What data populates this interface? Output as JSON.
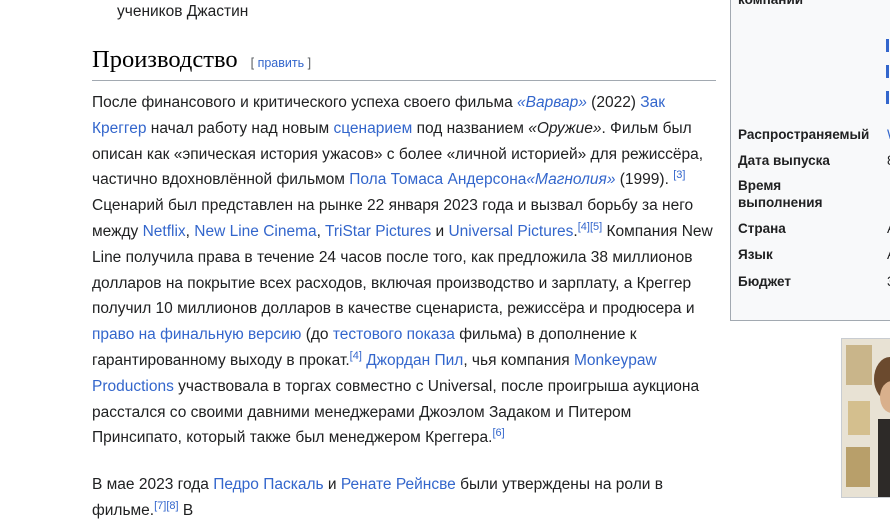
{
  "top_fragment": "учеников Джастин",
  "section": {
    "title": "Производство",
    "edit_open": "[ ",
    "edit_label": "править",
    "edit_close": " ]"
  },
  "para1": {
    "t01": "После финансового и критического успеха своего фильма ",
    "l01": "«Варвар»",
    "t02": " (2022) ",
    "l02": "Зак Креггер",
    "t03": " начал работу над новым ",
    "l03": "сценарием",
    "t04": " под названием ",
    "t05": "«Оружие»",
    "t06": ". Фильм был описан как «эпическая история ужасов» с более «личной историей» для режиссёра, частично вдохновлённой фильмом ",
    "l04": "Пола Томаса Андерсона",
    "l05": "«Магнолия»",
    "t07": " (1999).",
    "r01": "[3]",
    "t08": " Сценарий был представлен на рынке 22 января 2023 года и вызвал борьбу за него между ",
    "l06": "Netflix",
    "t09": ", ",
    "l07": "New Line Cinema",
    "t10": ", ",
    "l08": "TriStar Pictures",
    "t11": " и ",
    "l09": "Universal Pictures",
    "t12": ".",
    "r02": "[4]",
    "r03": "[5]",
    "t13": " Компания New Line получила права в течение 24 часов после того, как предложила 38  миллионов долларов на покрытие всех расходов, включая производство и зарплату, а Креггер получил 10  миллионов долларов в качестве сценариста, режиссёра и продюсера и ",
    "l10": "право на финальную версию",
    "t14": " (до ",
    "l11": "тестового показа",
    "t15": " фильма) в дополнение к гарантированному выходу в прокат.",
    "r04": "[4]",
    "t16": " ",
    "l12": "Джордан Пил",
    "t17": ", чья компания ",
    "l13": "Monkeypaw Productions",
    "t18": " участвовала в торгах совместно с Universal, после проигрыша аукциона расстался со своими давними менеджерами Джоэлом Задаком и Питером Принсипато, который также был менеджером Креггера.",
    "r05": "[6]"
  },
  "para2": {
    "t01": "В мае 2023 года ",
    "l01": "Педро Паскаль",
    "t02": " и ",
    "l02": "Ренате Рейнсве",
    "t03": " были утверждены на роли в фильме.",
    "r01": "[7]",
    "r02": "[8]",
    "t04": " В"
  },
  "infobox": {
    "rows": [
      {
        "label": "компании",
        "value": ""
      },
      {
        "label": "Распространяемый",
        "value": "W"
      },
      {
        "label": "Дата выпуска",
        "value": "8"
      },
      {
        "label": "Время выполнения",
        "value": ""
      },
      {
        "label": "Страна",
        "value": "А"
      },
      {
        "label": "Язык",
        "value": "А"
      },
      {
        "label": "Бюджет",
        "value": "3"
      }
    ]
  },
  "colors": {
    "link": "#3366cc",
    "text": "#202122",
    "border": "#a2a9b1",
    "infobox_bg": "#f8f9fa"
  }
}
